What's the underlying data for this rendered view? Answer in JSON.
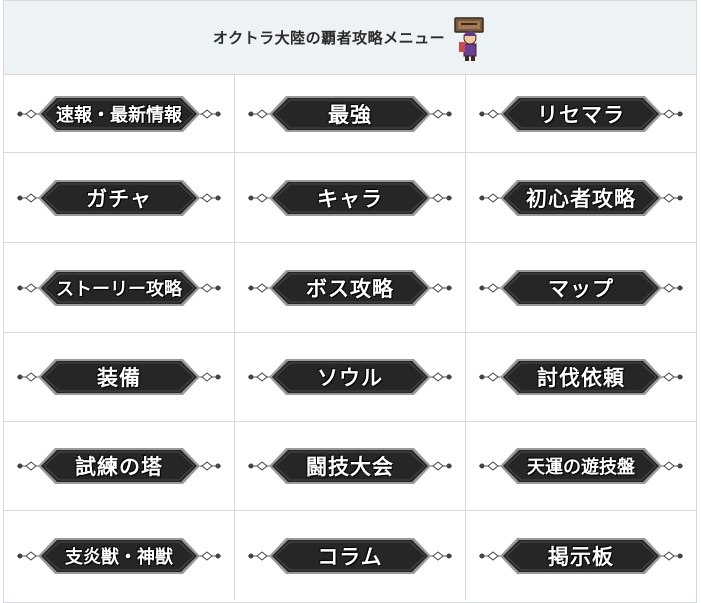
{
  "header": {
    "title": "オクトラ大陸の覇者攻略メニュー",
    "mascot_icon": "character-sign-icon"
  },
  "colors": {
    "header_bg": "#edf2f5",
    "border": "#d4dade",
    "button_fill": "#262626",
    "button_edge": "#9a9a9a"
  },
  "menu": {
    "items": [
      {
        "label": "速報・最新情報",
        "long": true
      },
      {
        "label": "最強"
      },
      {
        "label": "リセマラ"
      },
      {
        "label": "ガチャ"
      },
      {
        "label": "キャラ"
      },
      {
        "label": "初心者攻略"
      },
      {
        "label": "ストーリー攻略",
        "long": true
      },
      {
        "label": "ボス攻略"
      },
      {
        "label": "マップ"
      },
      {
        "label": "装備"
      },
      {
        "label": "ソウル"
      },
      {
        "label": "討伐依頼"
      },
      {
        "label": "試練の塔"
      },
      {
        "label": "闘技大会"
      },
      {
        "label": "天運の遊技盤",
        "long": true
      },
      {
        "label": "支炎獣・神獣",
        "long": true
      },
      {
        "label": "コラム"
      },
      {
        "label": "掲示板"
      }
    ]
  }
}
